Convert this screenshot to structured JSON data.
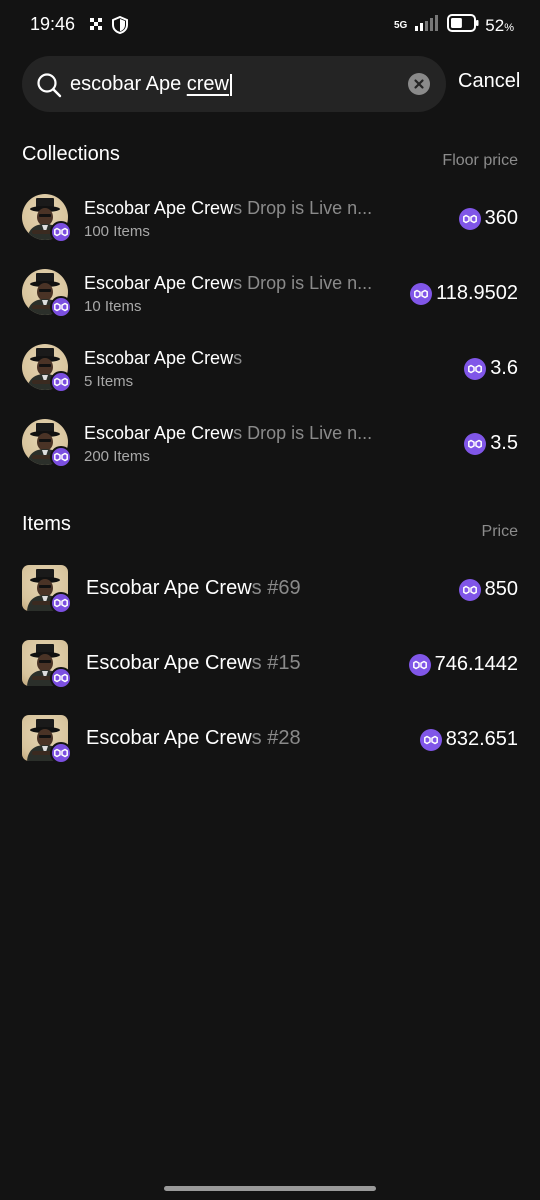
{
  "status_bar": {
    "time": "19:46",
    "network": "5G",
    "battery_percent": "52",
    "battery_unit": "%",
    "battery_level": 0.52
  },
  "search": {
    "value_plain": "escobar Ape ",
    "value_marked": "crew",
    "cancel_label": "Cancel"
  },
  "collections": {
    "title": "Collections",
    "column_label": "Floor price",
    "rows": [
      {
        "name_match": "Escobar Ape Crew",
        "name_rest": "s Drop is Live n...",
        "count": "100 Items",
        "price": "360"
      },
      {
        "name_match": "Escobar Ape Crew",
        "name_rest": "s Drop is Live n...",
        "count": "10 Items",
        "price": "118.9502"
      },
      {
        "name_match": "Escobar Ape Crew",
        "name_rest": "s",
        "count": "5 Items",
        "price": "3.6"
      },
      {
        "name_match": "Escobar Ape Crew",
        "name_rest": "s Drop is Live n...",
        "count": "200 Items",
        "price": "3.5"
      }
    ]
  },
  "items": {
    "title": "Items",
    "column_label": "Price",
    "rows": [
      {
        "name_match": "Escobar Ape Crew",
        "name_rest": "s #69",
        "price": "850"
      },
      {
        "name_match": "Escobar Ape Crew",
        "name_rest": "s #15",
        "price": "746.1442"
      },
      {
        "name_match": "Escobar Ape Crew",
        "name_rest": "s #28",
        "price": "832.651"
      }
    ]
  },
  "icons": {
    "currency": "polygon-matic-icon",
    "search": "search-icon",
    "clear": "clear-icon"
  },
  "colors": {
    "background": "#131313",
    "accent": "#7b4fe0",
    "dim_text": "#8a8a8a"
  }
}
